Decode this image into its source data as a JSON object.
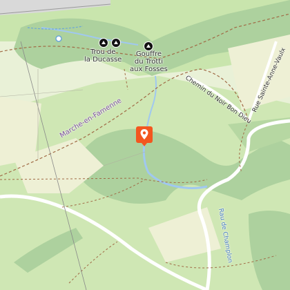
{
  "map": {
    "places": {
      "trou_de_la_ducasse": [
        "Trou de",
        "la Ducasse"
      ],
      "gouffre": [
        "Gouffre",
        "du Trotti",
        "aux Fosses"
      ]
    },
    "roads": {
      "marche_en_famenne": "Marche-en-Famenne",
      "chemin_du_noir_bon_dieu": "Chemin du Noir Bon Dieu",
      "rue_sainte_anne_vaulx": "Rue Sainte-Anne-Vaulx"
    },
    "waterways": {
      "ruisseau": "Rau de Champlon"
    },
    "marker": {
      "icon": "location-pin-icon",
      "color": "#f3561f"
    },
    "colors": {
      "forest": "#add19e",
      "meadow": "#cde8b0",
      "farmland": "#eef0d5",
      "water": "#a0c8f0",
      "road": "#ffffff",
      "path": "#a06a45"
    }
  }
}
